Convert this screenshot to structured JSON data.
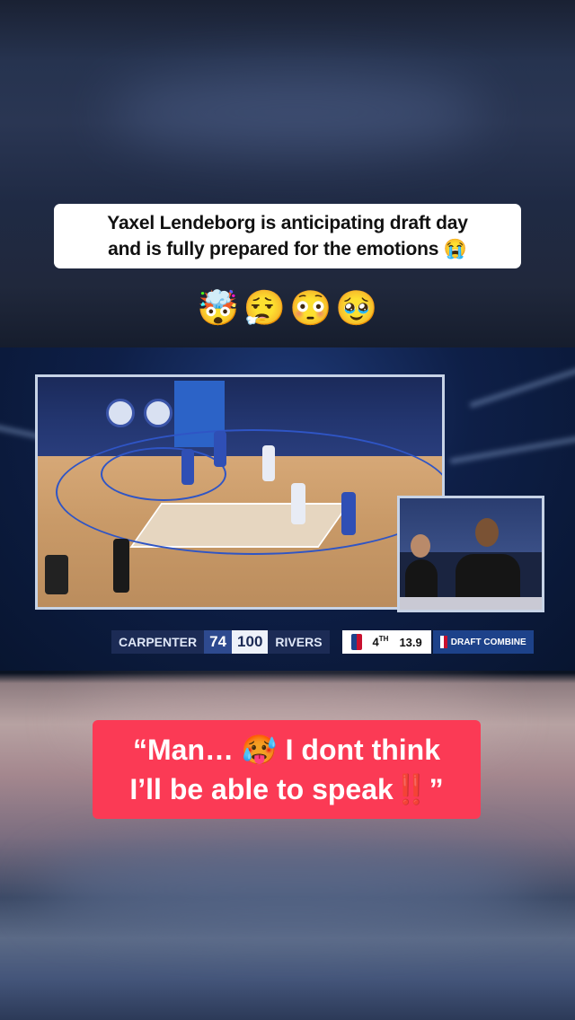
{
  "title_card": {
    "line1": "Yaxel Lendeborg is anticipating draft day",
    "line2": "and is fully prepared for the emotions 😭"
  },
  "emoji_row": [
    "🤯",
    "😮‍💨",
    "😳",
    "🥹"
  ],
  "scorebug": {
    "team_left": "CARPENTER",
    "score_left": "74",
    "score_right": "100",
    "team_right": "RIVERS",
    "quarter": "4",
    "quarter_suffix": "TH",
    "clock": "13.9",
    "brand": "DRAFT COMBINE"
  },
  "quote_card": {
    "line1": "“Man… 🥵 I dont think",
    "line2": "I’ll be able to speak‼️”"
  },
  "colors": {
    "quote_bg": "#fb3a55",
    "title_bg": "#ffffff"
  }
}
